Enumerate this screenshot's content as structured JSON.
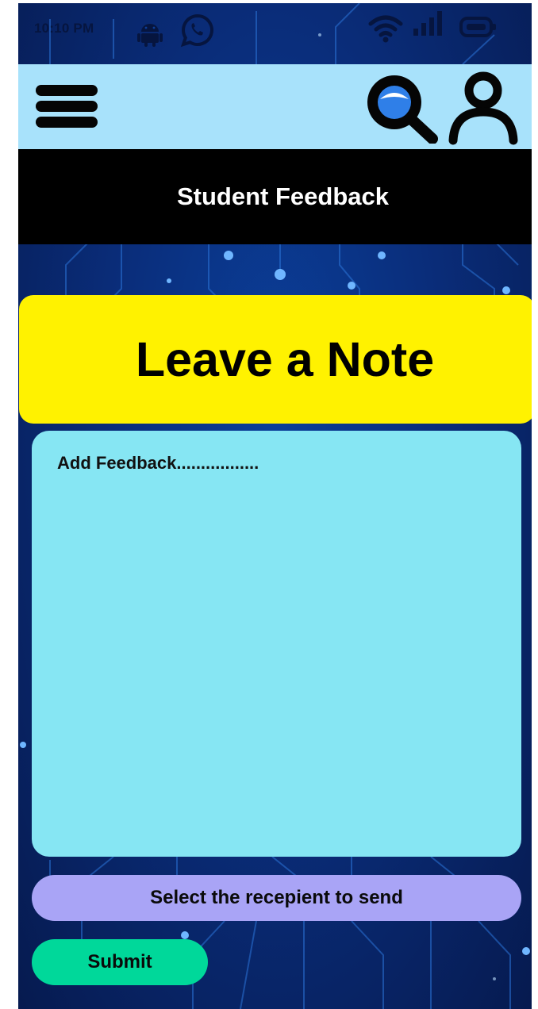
{
  "status_bar": {
    "time": "10:10 PM",
    "icons": [
      "android-icon",
      "whatsapp-icon",
      "wifi-icon",
      "signal-icon",
      "battery-icon"
    ]
  },
  "app_bar": {
    "icons": [
      "menu-icon",
      "search-icon",
      "profile-icon"
    ]
  },
  "header": {
    "title": "Student Feedback"
  },
  "banner": {
    "heading": "Leave a Note"
  },
  "feedback": {
    "placeholder": "Add Feedback.................",
    "value": ""
  },
  "recipient": {
    "label": "Select the recepient to send"
  },
  "actions": {
    "submit_label": "Submit"
  },
  "colors": {
    "app_bar": "#a8e2fb",
    "banner": "#fff200",
    "feedback_box": "#86e6f3",
    "recipient_button": "#a9a4f6",
    "submit_button": "#00d89a",
    "title_band": "#000000"
  }
}
